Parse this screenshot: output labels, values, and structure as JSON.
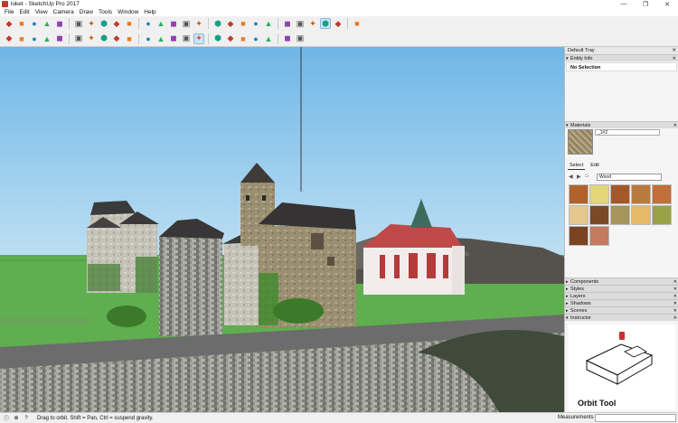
{
  "window": {
    "title": "loket - SketchUp Pro 2017",
    "minimize": "—",
    "maximize": "❐",
    "close": "✕"
  },
  "menu": [
    "File",
    "Edit",
    "View",
    "Camera",
    "Draw",
    "Tools",
    "Window",
    "Help"
  ],
  "toolbar1": [
    "component-icon",
    "warehouse-icon",
    "save-icon",
    "cut-icon",
    "copy-icon",
    "erase-icon",
    "paste-icon",
    "undo-icon",
    "redo-icon",
    "print-icon",
    "iso-view-icon",
    "top-view-icon",
    "front-view-icon",
    "right-view-icon",
    "back-view-icon",
    "left-view-icon",
    "xray-icon",
    "back-edges-icon",
    "wireframe-icon",
    "hidden-line-icon",
    "shaded-icon",
    "textured-icon",
    "monochrome-icon",
    "model-info-icon",
    "sandbox-icon",
    "shadow-icon"
  ],
  "toolbar2": [
    "select-icon",
    "eraser-icon",
    "pencil-icon",
    "arc-icon",
    "rectangle-icon",
    "pushpull-icon",
    "followme-icon",
    "move-icon",
    "rotate-icon",
    "scale-icon",
    "offset-icon",
    "tape-icon",
    "text-icon",
    "paint-icon",
    "orbit-icon",
    "pan-icon",
    "zoom-icon",
    "zoom-extents-icon",
    "warehouse-red-icon",
    "extension-icon",
    "ruby-icon",
    "geo-icon"
  ],
  "tray": {
    "title": "Default Tray",
    "entity_info": {
      "header": "Entity Info",
      "value": "No Selection"
    },
    "materials": {
      "header": "Materials",
      "name": "_1#2",
      "tab_select": "Select",
      "tab_edit": "Edit",
      "collection": "Wood",
      "swatches": [
        "#b0622a",
        "#e2d57a",
        "#a5582a",
        "#b97a3d",
        "#c07038",
        "#e3c78c",
        "#7a4a26",
        "#a5955a",
        "#e6b969",
        "#9aa246",
        "#7a4322",
        "#c47a5e"
      ]
    },
    "panels": [
      "Components",
      "Styles",
      "Layers",
      "Shadows",
      "Scenes",
      "Instructor"
    ],
    "instructor": {
      "tool": "Orbit Tool"
    }
  },
  "status": {
    "message": "Drag to orbit. Shift = Pan, Ctrl = suspend gravity.",
    "measurements_label": "Measurements"
  }
}
